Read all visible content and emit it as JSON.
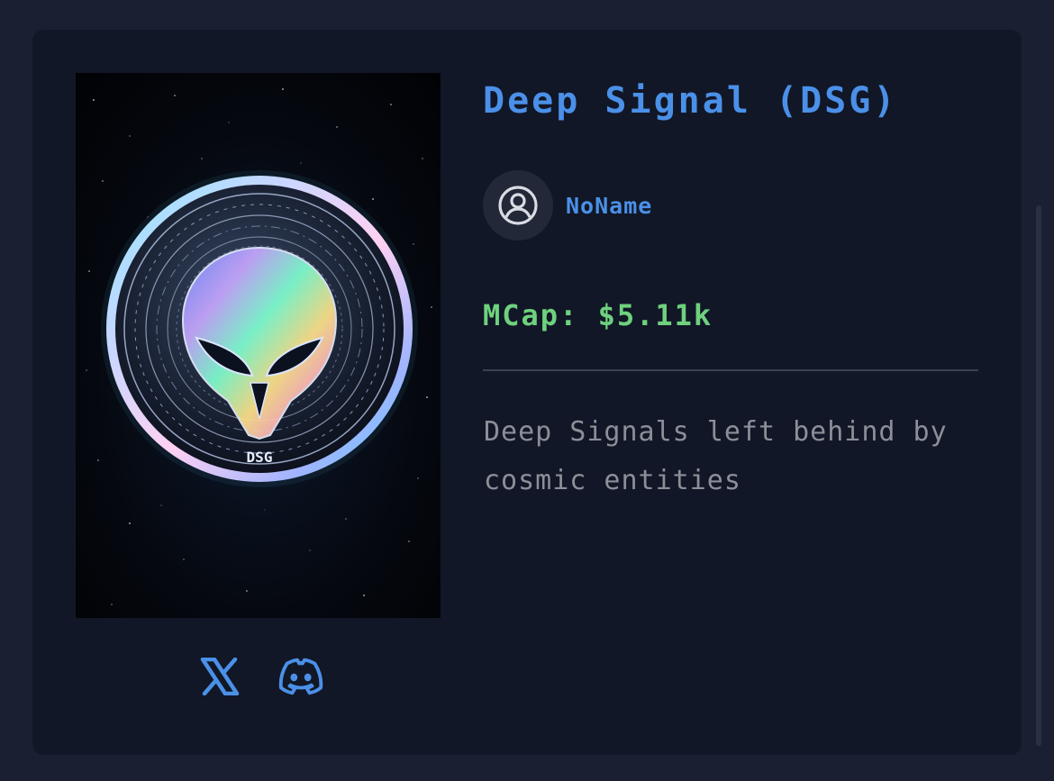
{
  "token": {
    "name": "Deep Signal (DSG)",
    "creator": "NoName",
    "mcap": "MCap: $5.11k",
    "description": "Deep Signals left behind by cosmic entities",
    "coin_engraving": "DSG"
  },
  "socials": [
    {
      "icon": "x-logo-icon",
      "label": "X"
    },
    {
      "icon": "discord-icon",
      "label": "Discord"
    }
  ],
  "colors": {
    "page_bg": "#1a2032",
    "card_bg": "#111726",
    "title": "#4b90e8",
    "mcap": "#6fd17e",
    "description": "#8c8f98"
  }
}
